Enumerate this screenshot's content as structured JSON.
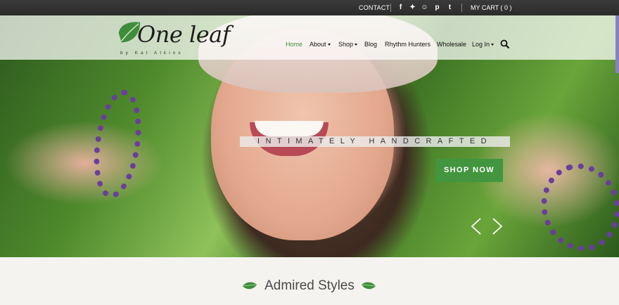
{
  "topbar": {
    "contact_label": "CONTACT",
    "social": [
      {
        "icon": "facebook-icon",
        "glyph": "f"
      },
      {
        "icon": "twitter-icon",
        "glyph": "✦"
      },
      {
        "icon": "etsy-icon",
        "glyph": "☺"
      },
      {
        "icon": "pinterest-icon",
        "glyph": "p"
      },
      {
        "icon": "tumblr-icon",
        "glyph": "t"
      }
    ],
    "cart_label": "MY CART ( 0 )"
  },
  "logo": {
    "name": "One leaf",
    "byline": "by Kat Atkins"
  },
  "nav": {
    "home": "Home",
    "about": "About",
    "shop": "Shop",
    "blog": "Blog",
    "rhythm_hunters": "Rhythm Hunters",
    "wholesale": "Wholesale",
    "login": "Log In",
    "search_icon": "search-icon",
    "active_color": "#3f8d3b"
  },
  "hero": {
    "tagline": "INTIMATELY HANDCRAFTED",
    "cta": "SHOP NOW",
    "cta_color": "#43953f"
  },
  "section": {
    "title": "Admired Styles"
  }
}
